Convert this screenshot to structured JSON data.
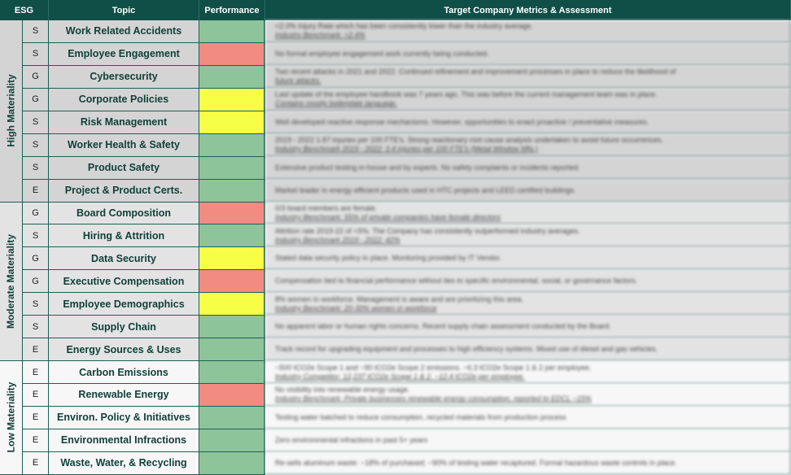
{
  "headers": {
    "esg": "ESG",
    "topic": "Topic",
    "performance": "Performance",
    "assessment": "Target Company Metrics & Assessment"
  },
  "groups": [
    {
      "label": "High Materiality",
      "rows": 8
    },
    {
      "label": "Moderate Materiality",
      "rows": 7
    },
    {
      "label": "Low Materiality",
      "rows": 5
    }
  ],
  "colors": {
    "header": "#0f4f47",
    "green": "#8ec49a",
    "red": "#f28b82",
    "yellow": "#f6ff45"
  },
  "rows": [
    {
      "esg": "S",
      "topic": "Work Related Accidents",
      "performance": "green",
      "line1": "<2.0% Injury Rate which has been consistently lower than the industry average.",
      "line2": "Industry Benchmark: <2.4%"
    },
    {
      "esg": "S",
      "topic": "Employee Engagement",
      "performance": "red",
      "line1": "No formal employee engagement work currently being conducted.",
      "line2": ""
    },
    {
      "esg": "G",
      "topic": "Cybersecurity",
      "performance": "green",
      "line1": "Two recent attacks in 2021 and 2022. Continued refinement and improvement processes in place to reduce the likelihood of",
      "line2": "future attacks."
    },
    {
      "esg": "G",
      "topic": "Corporate Policies",
      "performance": "yellow",
      "line1": "Last update of the employee handbook was 7 years ago. This was before the current management team was in place.",
      "line2": "Contains mostly boilerplate language."
    },
    {
      "esg": "S",
      "topic": "Risk Management",
      "performance": "yellow",
      "line1": "Well developed reactive response mechanisms. However, opportunities to enact proactive / preventative measures.",
      "line2": ""
    },
    {
      "esg": "S",
      "topic": "Worker Health & Safety",
      "performance": "green",
      "line1": "2019 - 2022 1.87 injuries per 100 FTE's. Strong reactionary root cause analysis undertaken to avoid future occurrences.",
      "line2": "Industry Benchmark 2019 - 2022: 3.4 injuries per 100 FTE's (Metal Window Mfg.)"
    },
    {
      "esg": "S",
      "topic": "Product Safety",
      "performance": "green",
      "line1": "Extensive product testing in-house and by experts. No safety complaints or incidents reported.",
      "line2": ""
    },
    {
      "esg": "E",
      "topic": "Project & Product Certs.",
      "performance": "green",
      "line1": "Market leader in energy efficient products used in HTC projects and LEED certified buildings.",
      "line2": ""
    },
    {
      "esg": "G",
      "topic": "Board Composition",
      "performance": "red",
      "line1": "0/3 board members are female.",
      "line2": "Industry Benchmark: 55% of private companies have female directors"
    },
    {
      "esg": "S",
      "topic": "Hiring & Attrition",
      "performance": "green",
      "line1": "Attrition rate 2019-22 of <5%. The Company has consistently outperformed industry averages.",
      "line2": "Industry Benchmark 2019 - 2022: 42%"
    },
    {
      "esg": "G",
      "topic": "Data Security",
      "performance": "yellow",
      "line1": "Stated data security policy in place. Monitoring provided by IT Vendor.",
      "line2": ""
    },
    {
      "esg": "G",
      "topic": "Executive Compensation",
      "performance": "red",
      "line1": "Compensation tied to financial performance without ties to specific environmental, social, or governance factors.",
      "line2": ""
    },
    {
      "esg": "S",
      "topic": "Employee Demographics",
      "performance": "yellow",
      "line1": "8% women in workforce. Management is aware and are prioritizing this area.",
      "line2": "Industry Benchmark: 20-30% women in workforce"
    },
    {
      "esg": "S",
      "topic": "Supply Chain",
      "performance": "green",
      "line1": "No apparent labor or human rights concerns. Recent supply chain assessment conducted by the Board.",
      "line2": ""
    },
    {
      "esg": "E",
      "topic": "Energy Sources & Uses",
      "performance": "green",
      "line1": "Track record for upgrading equipment and processes to high efficiency systems. Mixed use of diesel and gas vehicles.",
      "line2": ""
    },
    {
      "esg": "E",
      "topic": "Carbon Emissions",
      "performance": "green",
      "line1": "~500 tCO2e Scope 1 and ~90 tCO2e Scope 2 emissions. ~6.3 tCO2e Scope 1 & 2 per employee.",
      "line2": "Industry Competitor: 12,237 tCO2e Scope 1 & 2. ~12.4 tCO2e per employee."
    },
    {
      "esg": "E",
      "topic": "Renewable Energy",
      "performance": "red",
      "line1": "No visibility into renewable energy usage.",
      "line2": "Industry Benchmark: Private businesses renewable energy consumption, reported to EDCL ~15%"
    },
    {
      "esg": "E",
      "topic": "Environ. Policy & Initiatives",
      "performance": "green",
      "line1": "Testing water batched to reduce consumption, recycled materials from production process",
      "line2": ""
    },
    {
      "esg": "E",
      "topic": "Environmental Infractions",
      "performance": "green",
      "line1": "Zero environmental infractions in past 5+ years",
      "line2": ""
    },
    {
      "esg": "E",
      "topic": "Waste, Water, & Recycling",
      "performance": "green",
      "line1": "Re-sells aluminum waste: ~18% of purchased; ~90% of testing water recaptured. Formal hazardous waste controls in place.",
      "line2": ""
    }
  ]
}
